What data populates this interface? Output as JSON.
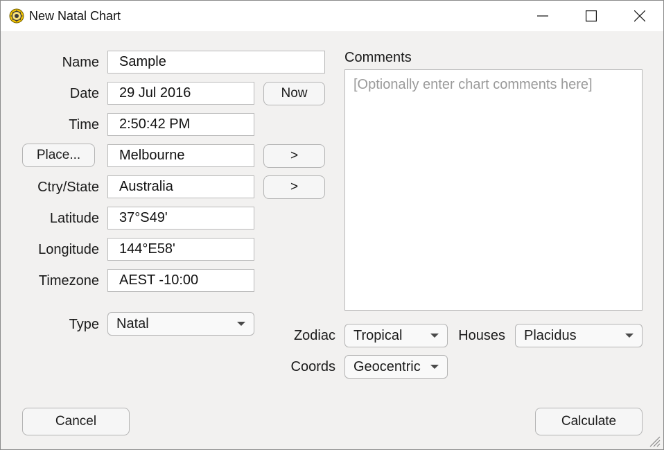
{
  "window": {
    "title": "New Natal Chart"
  },
  "form": {
    "name_label": "Name",
    "name_value": "Sample",
    "date_label": "Date",
    "date_value": "29 Jul 2016",
    "now_label": "Now",
    "time_label": "Time",
    "time_value": "2:50:42 PM",
    "place_button": "Place...",
    "place_value": "Melbourne",
    "place_next": ">",
    "country_label": "Ctry/State",
    "country_value": "Australia",
    "country_next": ">",
    "latitude_label": "Latitude",
    "latitude_value": "37°S49'",
    "longitude_label": "Longitude",
    "longitude_value": "144°E58'",
    "timezone_label": "Timezone",
    "timezone_value": "AEST -10:00",
    "type_label": "Type",
    "type_value": "Natal"
  },
  "comments": {
    "label": "Comments",
    "placeholder": "[Optionally enter chart comments here]"
  },
  "options": {
    "zodiac_label": "Zodiac",
    "zodiac_value": "Tropical",
    "houses_label": "Houses",
    "houses_value": "Placidus",
    "coords_label": "Coords",
    "coords_value": "Geocentric"
  },
  "footer": {
    "cancel_label": "Cancel",
    "calculate_label": "Calculate"
  },
  "icons": {
    "app": "astrology-wheel-icon",
    "minimize": "minimize-icon",
    "maximize": "maximize-icon",
    "close": "close-icon",
    "resize": "resize-grip-icon"
  },
  "colors": {
    "app_icon_fill": "#f2c200",
    "background": "#f2f1f0"
  }
}
